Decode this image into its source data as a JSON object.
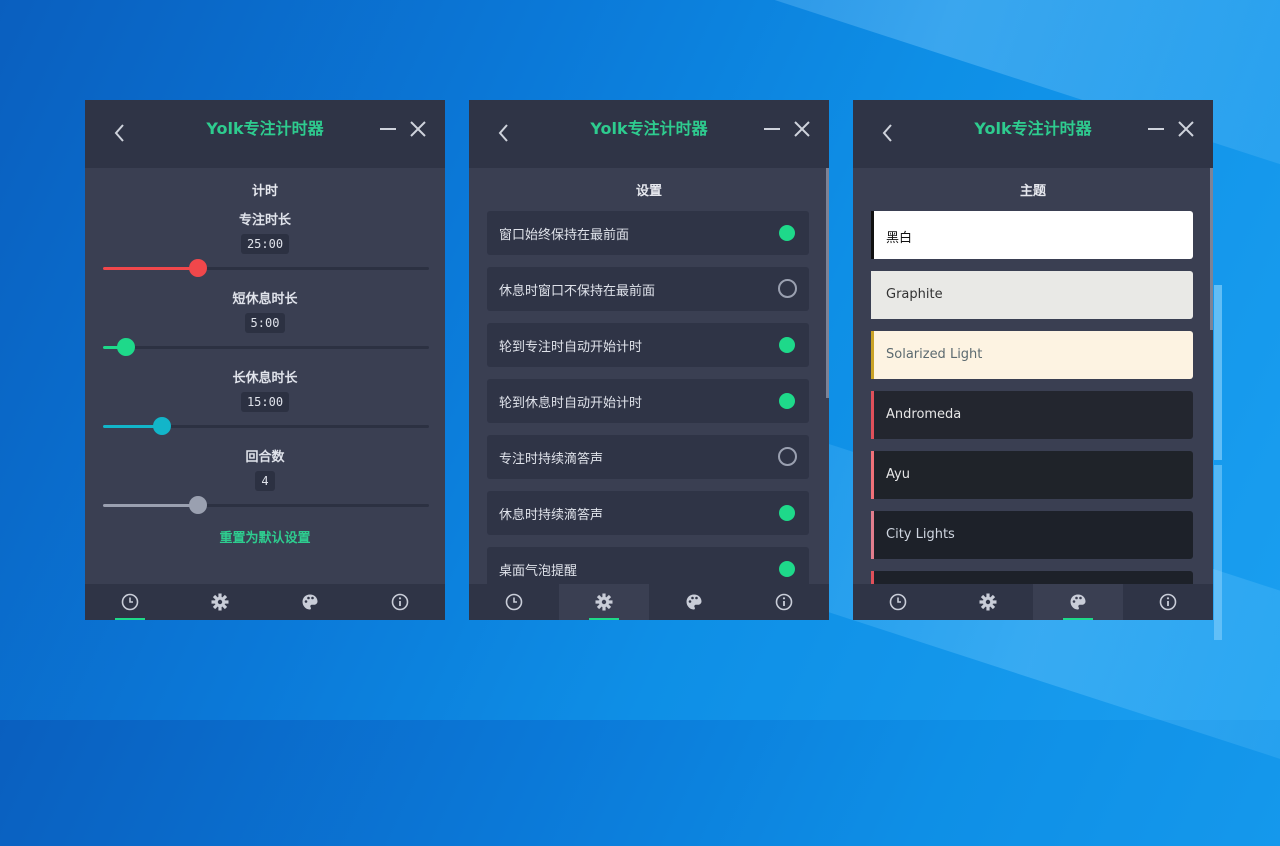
{
  "app": {
    "title": "Yolk专注计时器",
    "accent": "#2ecc8f"
  },
  "timer_page": {
    "section_title": "计时",
    "groups": [
      {
        "label": "专注时长",
        "value": "25:00",
        "level": 0.29,
        "color": "#f0474b"
      },
      {
        "label": "短休息时长",
        "value": "5:00",
        "level": 0.07,
        "color": "#1ed98a"
      },
      {
        "label": "长休息时长",
        "value": "15:00",
        "level": 0.18,
        "color": "#12b5c9"
      },
      {
        "label": "回合数",
        "value": "4",
        "level": 0.29,
        "color": "#9aa0b0"
      }
    ],
    "reset_label": "重置为默认设置"
  },
  "settings_page": {
    "section_title": "设置",
    "options": [
      {
        "label": "窗口始终保持在最前面",
        "on": true
      },
      {
        "label": "休息时窗口不保持在最前面",
        "on": false
      },
      {
        "label": "轮到专注时自动开始计时",
        "on": true
      },
      {
        "label": "轮到休息时自动开始计时",
        "on": true
      },
      {
        "label": "专注时持续滴答声",
        "on": false
      },
      {
        "label": "休息时持续滴答声",
        "on": true
      },
      {
        "label": "桌面气泡提醒",
        "on": true
      }
    ]
  },
  "theme_page": {
    "section_title": "主题",
    "themes": [
      {
        "label": "黑白",
        "bg": "#ffffff",
        "fg": "#111111",
        "bar": "#111111"
      },
      {
        "label": "Graphite",
        "bg": "#e9e9e6",
        "fg": "#333333",
        "bar": "#e9e9e6"
      },
      {
        "label": "Solarized Light",
        "bg": "#fdf3e2",
        "fg": "#5c6a70",
        "bar": "#c9a227"
      },
      {
        "label": "Andromeda",
        "bg": "#23262f",
        "fg": "#e6e6e6",
        "bar": "#e0505a"
      },
      {
        "label": "Ayu",
        "bg": "#1f2329",
        "fg": "#e6e6e6",
        "bar": "#f07178"
      },
      {
        "label": "City Lights",
        "bg": "#1d2129",
        "fg": "#cfd6e0",
        "bar": "#e27e8d"
      },
      {
        "label": "",
        "bg": "#1d2129",
        "fg": "#cfd6e0",
        "bar": "#e0505a"
      }
    ]
  },
  "nav_icons": [
    "clock-icon",
    "gear-icon",
    "palette-icon",
    "info-icon"
  ],
  "colors": {
    "titlebar": "#2f3446",
    "panel": "#3a3f52",
    "toggle_on": "#1ed98a"
  }
}
